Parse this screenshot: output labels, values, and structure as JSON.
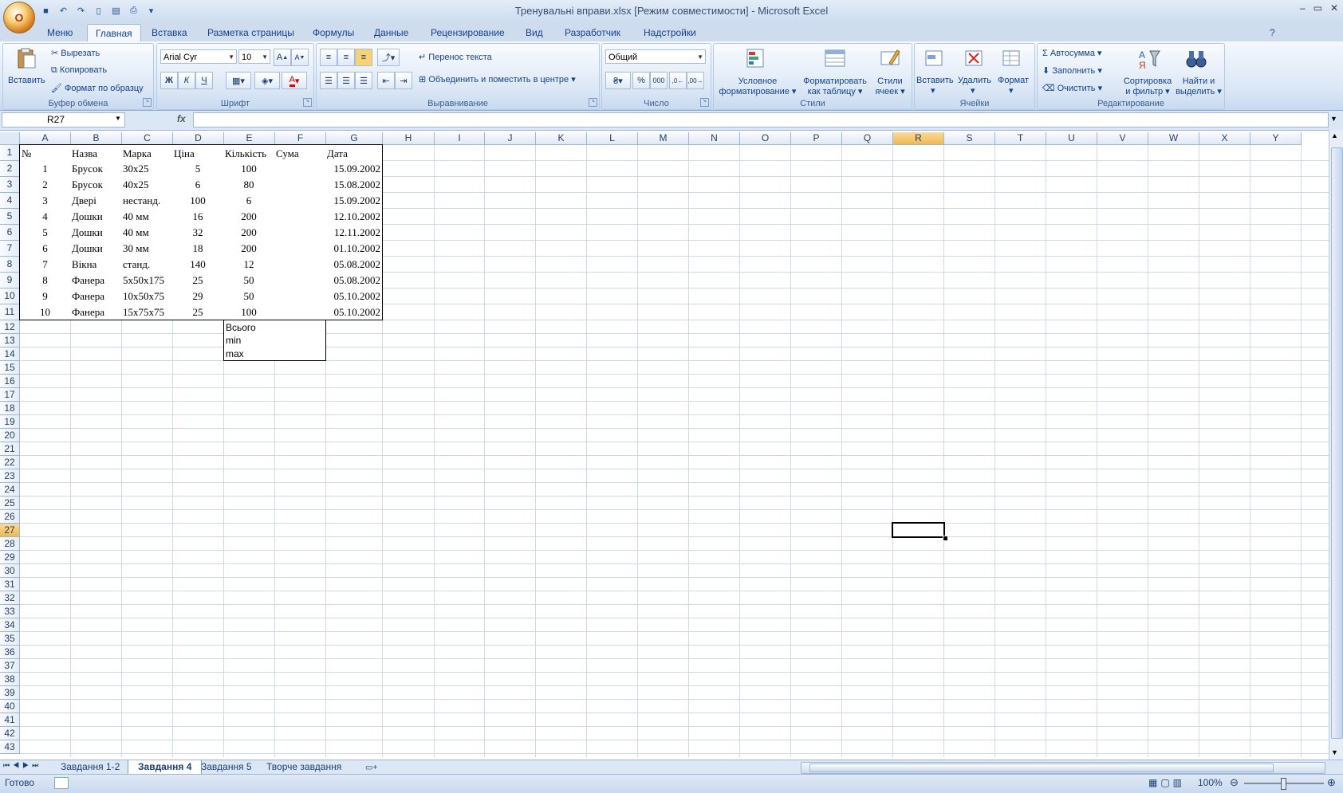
{
  "window": {
    "title": "Тренувальні вправи.xlsx  [Режим совместимости] - Microsoft Excel",
    "min": "–",
    "max": "▭",
    "close": "✕"
  },
  "office_button": "O",
  "ribbon_tabs": [
    "Меню",
    "Главная",
    "Вставка",
    "Разметка страницы",
    "Формулы",
    "Данные",
    "Рецензирование",
    "Вид",
    "Разработчик",
    "Надстройки"
  ],
  "ribbon": {
    "clipboard": {
      "label": "Буфер обмена",
      "paste": "Вставить",
      "cut": "Вырезать",
      "copy": "Копировать",
      "format_painter": "Формат по образцу"
    },
    "font": {
      "label": "Шрифт",
      "name": "Arial Cyr",
      "size": "10",
      "bold": "Ж",
      "italic": "К",
      "underline": "Ч",
      "grow": "A",
      "shrink": "A"
    },
    "alignment": {
      "label": "Выравнивание",
      "wrap": "Перенос текста",
      "merge": "Объединить и поместить в центре"
    },
    "number": {
      "label": "Число",
      "format": "Общий",
      "percent": "%",
      "thousands": "000"
    },
    "styles": {
      "label": "Стили",
      "cond1": "Условное",
      "cond2": "форматирование",
      "table1": "Форматировать",
      "table2": "как таблицу",
      "cell1": "Стили",
      "cell2": "ячеек"
    },
    "cells": {
      "label": "Ячейки",
      "insert": "Вставить",
      "delete": "Удалить",
      "format": "Формат"
    },
    "editing": {
      "label": "Редактирование",
      "autosum": "Автосумма",
      "fill": "Заполнить",
      "clear": "Очистить",
      "sort1": "Сортировка",
      "sort2": "и фильтр",
      "find1": "Найти и",
      "find2": "выделить"
    }
  },
  "formula_bar": {
    "name_box": "R27",
    "fx": "fx",
    "formula": ""
  },
  "columns": [
    "A",
    "B",
    "C",
    "D",
    "E",
    "F",
    "G",
    "H",
    "I",
    "J",
    "K",
    "L",
    "M",
    "N",
    "O",
    "P",
    "Q",
    "R",
    "S",
    "T",
    "U",
    "V",
    "W",
    "X",
    "Y"
  ],
  "rows": [
    "1",
    "2",
    "3",
    "4",
    "5",
    "6",
    "7",
    "8",
    "9",
    "10",
    "11",
    "12",
    "13",
    "14",
    "15",
    "16",
    "17",
    "18",
    "19",
    "20",
    "21",
    "22",
    "23",
    "24",
    "25",
    "26",
    "27",
    "28",
    "29",
    "30",
    "31",
    "32",
    "33",
    "34",
    "35",
    "36",
    "37",
    "38",
    "39",
    "40",
    "41",
    "42",
    "43"
  ],
  "table": {
    "headers": [
      "№",
      "Назва",
      "Марка",
      "Ціна",
      "Кількість",
      "Сума",
      "Дата"
    ],
    "rows": [
      [
        "1",
        "Брусок",
        "30x25",
        "5",
        "100",
        "",
        "15.09.2002"
      ],
      [
        "2",
        "Брусок",
        "40x25",
        "6",
        "80",
        "",
        "15.08.2002"
      ],
      [
        "3",
        "Двері",
        "нестанд.",
        "100",
        "6",
        "",
        "15.09.2002"
      ],
      [
        "4",
        "Дошки",
        "40 мм",
        "16",
        "200",
        "",
        "12.10.2002"
      ],
      [
        "5",
        "Дошки",
        "40 мм",
        "32",
        "200",
        "",
        "12.11.2002"
      ],
      [
        "6",
        "Дошки",
        "30 мм",
        "18",
        "200",
        "",
        "01.10.2002"
      ],
      [
        "7",
        "Вікна",
        "станд.",
        "140",
        "12",
        "",
        "05.08.2002"
      ],
      [
        "8",
        "Фанера",
        "5x50x175",
        "25",
        "50",
        "",
        "05.08.2002"
      ],
      [
        "9",
        "Фанера",
        "10x50x75",
        "29",
        "50",
        "",
        "05.10.2002"
      ],
      [
        "10",
        "Фанера",
        "15x75x75",
        "25",
        "100",
        "",
        "05.10.2002"
      ]
    ],
    "summary": [
      "Всього",
      "min",
      "max"
    ]
  },
  "sheet_tabs": [
    "Завдання 1-2",
    "Завдання 4",
    "Завдання 5",
    "Творче завдання"
  ],
  "active_sheet": "Завдання 4",
  "status": {
    "ready": "Готово",
    "zoom": "100%"
  }
}
